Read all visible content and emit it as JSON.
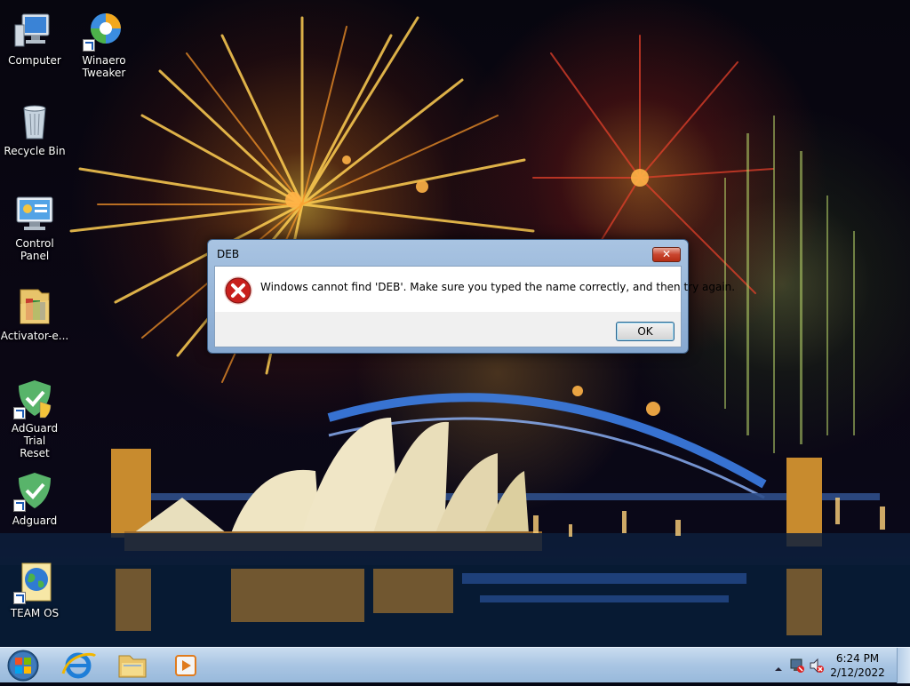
{
  "desktop": {
    "icons": [
      {
        "label": "Computer",
        "icon": "computer-icon"
      },
      {
        "label": "Winaero\nTweaker",
        "icon": "winaero-tweaker-icon"
      },
      {
        "label": "Recycle Bin",
        "icon": "recycle-bin-icon"
      },
      {
        "label": "Control Panel",
        "icon": "control-panel-icon"
      },
      {
        "label": "Activator-e...",
        "icon": "folder-icon"
      },
      {
        "label": "AdGuard Trial\nReset",
        "icon": "adguard-shield-icon"
      },
      {
        "label": "Adguard",
        "icon": "adguard-shield-icon"
      },
      {
        "label": "TEAM OS",
        "icon": "globe-icon"
      }
    ]
  },
  "dialog": {
    "title": "DEB",
    "close_label": "✕",
    "message": "Windows cannot find 'DEB'. Make sure you typed the name correctly, and then try again.",
    "ok_label": "OK",
    "icon": "error-icon"
  },
  "taskbar": {
    "start": "windows-start-orb",
    "pinned": [
      {
        "name": "Internet Explorer",
        "icon": "internet-explorer-icon"
      },
      {
        "name": "Windows Explorer",
        "icon": "file-explorer-icon"
      },
      {
        "name": "Media Player",
        "icon": "media-player-icon"
      }
    ],
    "tray": {
      "icons": [
        "show-hidden-icons-arrow",
        "network-icon",
        "volume-muted-icon"
      ],
      "time": "6:24 PM",
      "date": "2/12/2022"
    }
  },
  "colors": {
    "taskbar": "#a9c5e3",
    "dialog_frame": "#86a8d0",
    "error_red": "#c8201d",
    "ok_border": "#2c628b"
  }
}
